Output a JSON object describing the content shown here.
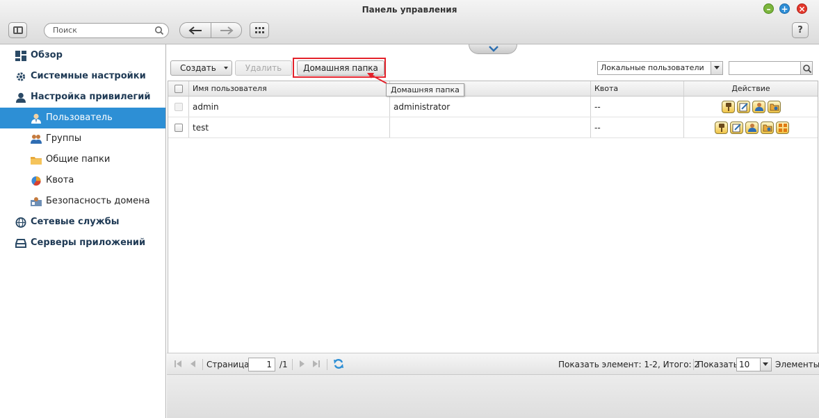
{
  "window": {
    "title": "Панель управления"
  },
  "toolbar": {
    "search_placeholder": "Поиск",
    "help_label": "?"
  },
  "sidebar": {
    "items": [
      {
        "label": "Обзор"
      },
      {
        "label": "Системные настройки"
      },
      {
        "label": "Настройка привилегий"
      },
      {
        "label": "Пользователь"
      },
      {
        "label": "Группы"
      },
      {
        "label": "Общие папки"
      },
      {
        "label": "Квота"
      },
      {
        "label": "Безопасность домена"
      },
      {
        "label": "Сетевые службы"
      },
      {
        "label": "Серверы приложений"
      }
    ]
  },
  "main": {
    "buttons": {
      "create": "Создать",
      "delete": "Удалить",
      "home_folder": "Домашняя папка"
    },
    "filter": {
      "selected": "Локальные пользователи"
    },
    "tooltip": "Домашняя папка",
    "table": {
      "columns": [
        "Имя пользователя",
        "",
        "Квота",
        "Действие"
      ],
      "rows": [
        {
          "name": "admin",
          "description": "administrator",
          "quota": "--"
        },
        {
          "name": "test",
          "description": "",
          "quota": "--"
        }
      ]
    },
    "pager": {
      "page_label": "Страница",
      "page_value": "1",
      "page_total": "/1",
      "summary": "Показать элемент: 1-2, Итого: 2",
      "show_label": "Показать",
      "per_page": "10",
      "items_label": "Элементы"
    }
  },
  "colors": {
    "accent": "#2d8fd5",
    "highlight": "#e3222b"
  }
}
